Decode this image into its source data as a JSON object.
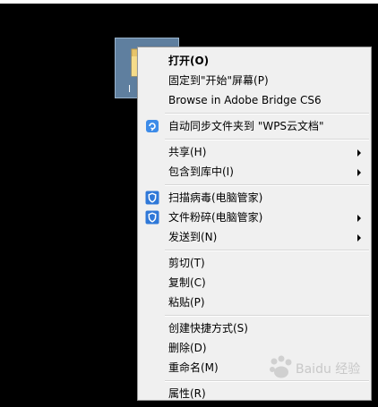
{
  "menu": {
    "items": [
      {
        "label": "打开(O)",
        "icon": null,
        "submenu": false,
        "bold": true
      },
      {
        "label": "固定到\"开始\"屏幕(P)",
        "icon": null,
        "submenu": false
      },
      {
        "label": "Browse in Adobe Bridge CS6",
        "icon": null,
        "submenu": false
      },
      {
        "label": "自动同步文件夹到 \"WPS云文档\"",
        "icon": "wps-cloud-sync-icon",
        "submenu": false
      },
      {
        "label": "共享(H)",
        "icon": null,
        "submenu": true
      },
      {
        "label": "包含到库中(I)",
        "icon": null,
        "submenu": true
      },
      {
        "label": "扫描病毒(电脑管家)",
        "icon": "shield-icon",
        "submenu": false
      },
      {
        "label": "文件粉碎(电脑管家)",
        "icon": "shield-icon",
        "submenu": true
      },
      {
        "label": "发送到(N)",
        "icon": null,
        "submenu": true
      },
      {
        "label": "剪切(T)",
        "icon": null,
        "submenu": false
      },
      {
        "label": "复制(C)",
        "icon": null,
        "submenu": false
      },
      {
        "label": "粘贴(P)",
        "icon": null,
        "submenu": false
      },
      {
        "label": "创建快捷方式(S)",
        "icon": null,
        "submenu": false
      },
      {
        "label": "删除(D)",
        "icon": null,
        "submenu": false
      },
      {
        "label": "重命名(M)",
        "icon": null,
        "submenu": false
      },
      {
        "label": "属性(R)",
        "icon": null,
        "submenu": false
      }
    ]
  },
  "folder": {
    "name_partial": "l",
    "icon": "folder-icon"
  },
  "watermark": {
    "text": "Baidu 经验"
  },
  "colors": {
    "background": "#000000",
    "menu_bg": "#f0f0f0",
    "shield_blue": "#2f78d8"
  }
}
